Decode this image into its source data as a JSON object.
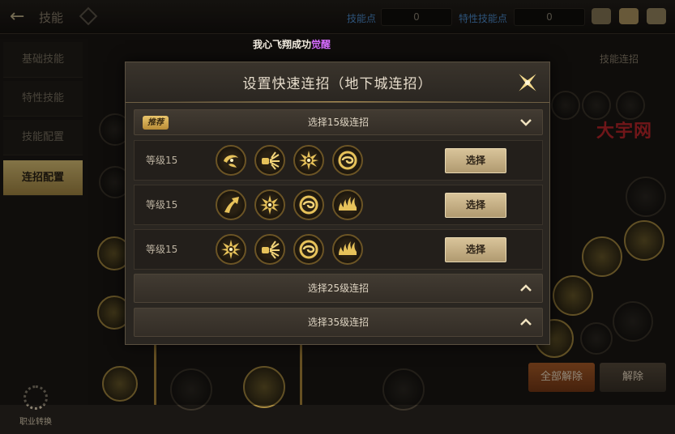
{
  "topbar": {
    "back_icon": "arrow-left-icon",
    "title": "技能",
    "skill_points_label": "技能点",
    "skill_points_value": "0",
    "trait_points_label": "特性技能点",
    "trait_points_value": "0"
  },
  "notice": {
    "prefix": "我心飞翔成功",
    "highlight": "觉醒"
  },
  "sidebar": {
    "items": [
      {
        "label": "基础技能"
      },
      {
        "label": "特性技能"
      },
      {
        "label": "技能配置"
      },
      {
        "label": "连招配置"
      }
    ],
    "job_change_label": "职业转换"
  },
  "background": {
    "right_link": "技能连招",
    "btn_unlock_all": "全部解除",
    "btn_unlock": "解除",
    "watermark": "大宇网"
  },
  "modal": {
    "title": "设置快速连招（地下城连招）",
    "sections": [
      {
        "badge": "推荐",
        "title": "选择15级连招",
        "expanded": true,
        "rows": [
          {
            "level": "等级15",
            "select_label": "选择",
            "icons": [
              "swirl-slash-icon",
              "burst-fist-icon",
              "star-sun-icon",
              "spiral-ring-icon"
            ]
          },
          {
            "level": "等级15",
            "select_label": "选择",
            "icons": [
              "upward-kick-icon",
              "star-sun-icon",
              "spiral-ring-icon",
              "flame-wave-icon"
            ]
          },
          {
            "level": "等级15",
            "select_label": "选择",
            "icons": [
              "star-sun-icon",
              "burst-fist-icon",
              "spiral-ring-icon",
              "flame-wave-icon"
            ]
          }
        ]
      },
      {
        "badge": "",
        "title": "选择25级连招",
        "expanded": false,
        "rows": []
      },
      {
        "badge": "",
        "title": "选择35级连招",
        "expanded": false,
        "rows": []
      }
    ]
  },
  "colors": {
    "gold": "#d9b25a",
    "select_button": "#c9b489",
    "recommend_badge": "#d8ad50"
  }
}
